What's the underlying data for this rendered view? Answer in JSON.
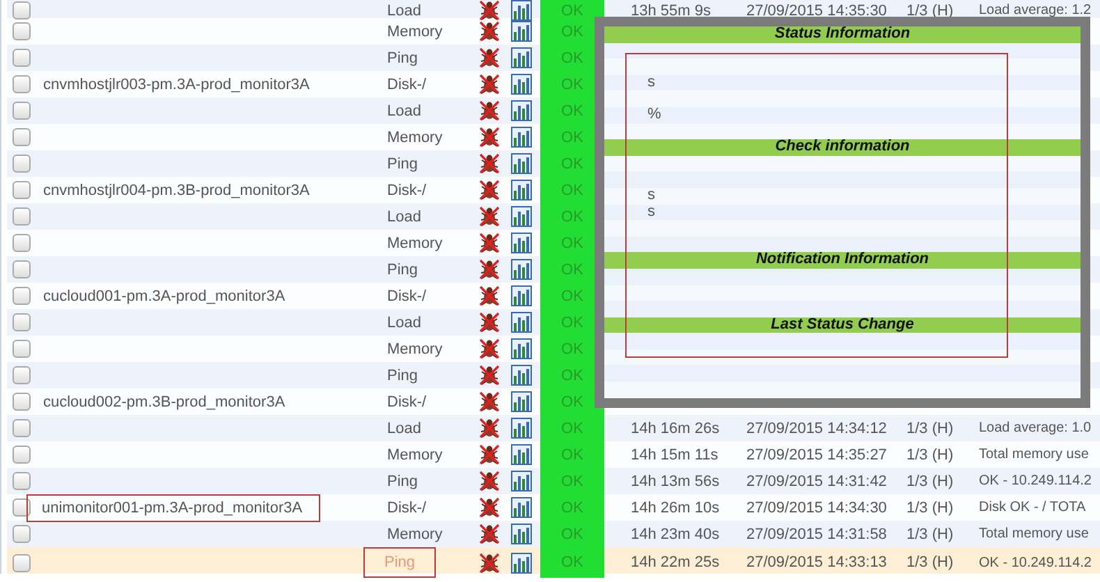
{
  "rows": [
    {
      "service": "Load",
      "status": "OK",
      "duration": "13h 55m 9s",
      "last_check": "27/09/2015 14:35:30",
      "attempt": "1/3 (H)",
      "info": "Load average: 1.2",
      "selected": false
    },
    {
      "service": "Memory",
      "status": "OK",
      "selected": false
    },
    {
      "service": "Ping",
      "status": "OK",
      "selected": false
    },
    {
      "host": "cnvmhostjlr003-pm.3A-prod_monitor3A",
      "service": "Disk-/",
      "status": "OK",
      "selected": false
    },
    {
      "service": "Load",
      "status": "OK",
      "selected": false
    },
    {
      "service": "Memory",
      "status": "OK",
      "selected": false
    },
    {
      "service": "Ping",
      "status": "OK",
      "selected": false
    },
    {
      "host": "cnvmhostjlr004-pm.3B-prod_monitor3A",
      "service": "Disk-/",
      "status": "OK",
      "selected": false
    },
    {
      "service": "Load",
      "status": "OK",
      "selected": false
    },
    {
      "service": "Memory",
      "status": "OK",
      "selected": false
    },
    {
      "service": "Ping",
      "status": "OK",
      "selected": false
    },
    {
      "host": "cucloud001-pm.3A-prod_monitor3A",
      "service": "Disk-/",
      "status": "OK",
      "selected": false
    },
    {
      "service": "Load",
      "status": "OK",
      "selected": false
    },
    {
      "service": "Memory",
      "status": "OK",
      "selected": false
    },
    {
      "service": "Ping",
      "status": "OK",
      "selected": false
    },
    {
      "host": "cucloud002-pm.3B-prod_monitor3A",
      "service": "Disk-/",
      "status": "OK",
      "selected": false
    },
    {
      "service": "Load",
      "status": "OK",
      "duration": "14h 16m 26s",
      "last_check": "27/09/2015 14:34:12",
      "attempt": "1/3 (H)",
      "info": "Load average: 1.0",
      "selected": false
    },
    {
      "service": "Memory",
      "status": "OK",
      "duration": "14h 15m 11s",
      "last_check": "27/09/2015 14:35:27",
      "attempt": "1/3 (H)",
      "info": "Total memory use",
      "selected": false
    },
    {
      "service": "Ping",
      "status": "OK",
      "duration": "14h 13m 56s",
      "last_check": "27/09/2015 14:31:42",
      "attempt": "1/3 (H)",
      "info": "OK - 10.249.114.2",
      "selected": false
    },
    {
      "host": "unimonitor001-pm.3A-prod_monitor3A",
      "host_marked": true,
      "service": "Disk-/",
      "status": "OK",
      "duration": "14h 26m 10s",
      "last_check": "27/09/2015 14:34:30",
      "attempt": "1/3 (H)",
      "info": "Disk OK - / TOTA",
      "selected": false
    },
    {
      "service": "Memory",
      "status": "OK",
      "duration": "14h 23m 40s",
      "last_check": "27/09/2015 14:31:58",
      "attempt": "1/3 (H)",
      "info": "Total memory use",
      "selected": false
    },
    {
      "service": "Ping",
      "service_marked": true,
      "status": "OK",
      "duration": "14h 22m 25s",
      "last_check": "27/09/2015 14:33:13",
      "attempt": "1/3 (H)",
      "info": "OK - 10.249.114.2",
      "selected": true
    }
  ],
  "popup": {
    "marked": true,
    "rows": [
      {
        "kind": "header",
        "text": "Status Information"
      },
      {
        "kind": "value"
      },
      {
        "kind": "value"
      },
      {
        "kind": "value",
        "text": "s"
      },
      {
        "kind": "value"
      },
      {
        "kind": "value",
        "text": "%"
      },
      {
        "kind": "value"
      },
      {
        "kind": "header",
        "text": "Check information"
      },
      {
        "kind": "value"
      },
      {
        "kind": "value"
      },
      {
        "kind": "value",
        "text": "s"
      },
      {
        "kind": "value",
        "text": "s"
      },
      {
        "kind": "value"
      },
      {
        "kind": "value"
      },
      {
        "kind": "header",
        "text": "Notification Information"
      },
      {
        "kind": "value"
      },
      {
        "kind": "value"
      },
      {
        "kind": "value"
      },
      {
        "kind": "header",
        "text": "Last Status Change"
      },
      {
        "kind": "value"
      },
      {
        "kind": "value"
      },
      {
        "kind": "value"
      },
      {
        "kind": "value"
      }
    ]
  }
}
